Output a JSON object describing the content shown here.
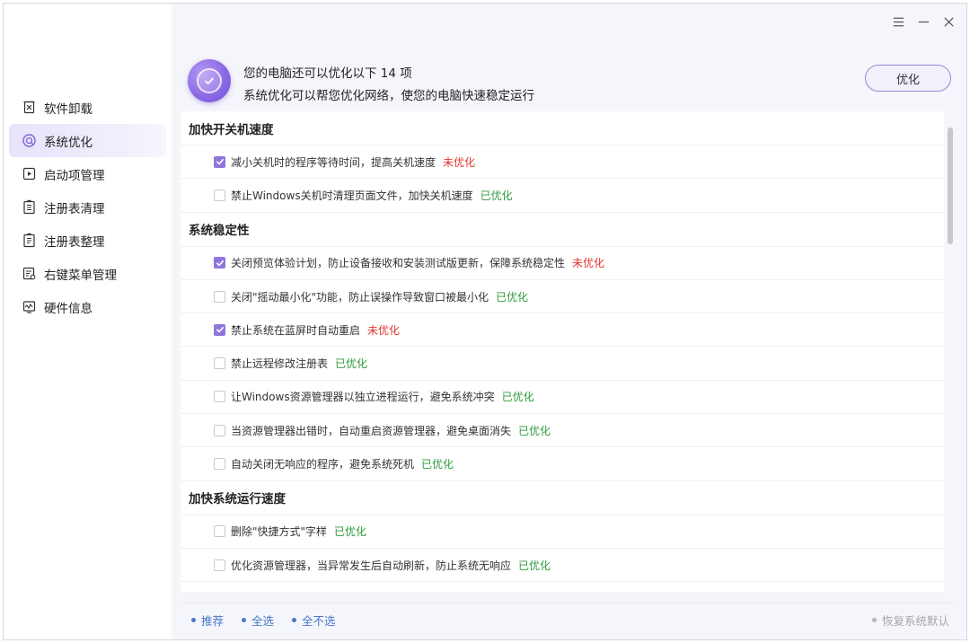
{
  "colors": {
    "accent": "#8f76de",
    "not_optimized": "#e2332f",
    "optimized": "#2e9a3c",
    "link": "#4a78c8"
  },
  "sidebar": {
    "items": [
      {
        "label": "软件卸载",
        "icon": "trash-icon",
        "active": false
      },
      {
        "label": "系统优化",
        "icon": "system-optimize-icon",
        "active": true
      },
      {
        "label": "启动项管理",
        "icon": "startup-icon",
        "active": false
      },
      {
        "label": "注册表清理",
        "icon": "registry-clean-icon",
        "active": false
      },
      {
        "label": "注册表整理",
        "icon": "registry-defrag-icon",
        "active": false
      },
      {
        "label": "右键菜单管理",
        "icon": "context-menu-icon",
        "active": false
      },
      {
        "label": "硬件信息",
        "icon": "hardware-icon",
        "active": false
      }
    ]
  },
  "header": {
    "title": "您的电脑还可以优化以下 14 项",
    "subtitle": "系统优化可以帮您优化网络，使您的电脑快速稳定运行",
    "optimize_label": "优化"
  },
  "sections": [
    {
      "title": "加快开关机速度",
      "items": [
        {
          "label": "减小关机时的程序等待时间，提高关机速度",
          "checked": true,
          "status": "未优化",
          "optimized": false
        },
        {
          "label": "禁止Windows关机时清理页面文件，加快关机速度",
          "checked": false,
          "status": "已优化",
          "optimized": true
        }
      ]
    },
    {
      "title": "系统稳定性",
      "items": [
        {
          "label": "关闭预览体验计划，防止设备接收和安装测试版更新，保障系统稳定性",
          "checked": true,
          "status": "未优化",
          "optimized": false
        },
        {
          "label": "关闭\"摇动最小化\"功能，防止误操作导致窗口被最小化",
          "checked": false,
          "status": "已优化",
          "optimized": true
        },
        {
          "label": "禁止系统在蓝屏时自动重启",
          "checked": true,
          "status": "未优化",
          "optimized": false
        },
        {
          "label": "禁止远程修改注册表",
          "checked": false,
          "status": "已优化",
          "optimized": true
        },
        {
          "label": "让Windows资源管理器以独立进程运行，避免系统冲突",
          "checked": false,
          "status": "已优化",
          "optimized": true
        },
        {
          "label": "当资源管理器出错时，自动重启资源管理器，避免桌面消失",
          "checked": false,
          "status": "已优化",
          "optimized": true
        },
        {
          "label": "自动关闭无响应的程序，避免系统死机",
          "checked": false,
          "status": "已优化",
          "optimized": true
        }
      ]
    },
    {
      "title": "加快系统运行速度",
      "items": [
        {
          "label": "删除\"快捷方式\"字样",
          "checked": false,
          "status": "已优化",
          "optimized": true
        },
        {
          "label": "优化资源管理器，当异常发生后自动刷新，防止系统无响应",
          "checked": false,
          "status": "已优化",
          "optimized": true
        }
      ]
    }
  ],
  "footer": {
    "recommend": "推荐",
    "select_all": "全选",
    "select_none": "全不选",
    "restore": "恢复系统默认"
  }
}
